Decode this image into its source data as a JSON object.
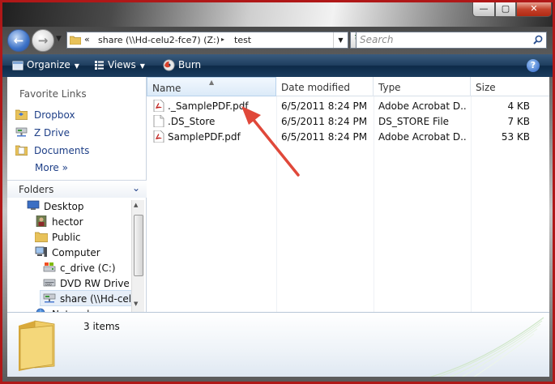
{
  "window": {
    "minimize_glyph": "—",
    "maximize_glyph": "▢",
    "close_glyph": "✕"
  },
  "address": {
    "chevron": "«",
    "crumbs": [
      "share (\\\\Hd-celu2-fce7) (Z:)",
      "test"
    ],
    "separator": "▸",
    "dropdown_glyph": "▼"
  },
  "search": {
    "placeholder": "Search"
  },
  "toolbar": {
    "organize": "Organize",
    "views": "Views",
    "burn": "Burn",
    "help": "?"
  },
  "nav": {
    "favorites_header": "Favorite Links",
    "favorites": [
      "Dropbox",
      "Z Drive",
      "Documents"
    ],
    "more": "More",
    "more_glyph": "»",
    "folders_header": "Folders",
    "folders_chevron": "⌄",
    "tree": {
      "desktop": "Desktop",
      "hector": "hector",
      "public": "Public",
      "computer": "Computer",
      "cdrive": "c_drive (C:)",
      "dvd": "DVD RW Drive (E",
      "share": "share (\\\\Hd-celu",
      "network": "Network"
    }
  },
  "columns": {
    "name": "Name",
    "date": "Date modified",
    "type": "Type",
    "size": "Size"
  },
  "files": [
    {
      "name": "._SamplePDF.pdf",
      "date": "6/5/2011 8:24 PM",
      "type": "Adobe Acrobat D...",
      "size": "4 KB",
      "icon": "pdf-icon"
    },
    {
      "name": ".DS_Store",
      "date": "6/5/2011 8:24 PM",
      "type": "DS_STORE File",
      "size": "7 KB",
      "icon": "blank-file-icon"
    },
    {
      "name": "SamplePDF.pdf",
      "date": "6/5/2011 8:24 PM",
      "type": "Adobe Acrobat D...",
      "size": "53 KB",
      "icon": "pdf-icon"
    }
  ],
  "details": {
    "item_count": "3 items"
  },
  "colors": {
    "frame": "#b01818",
    "toolbar": "#1f3f60",
    "link": "#1e3f87",
    "arrow": "#e0483a"
  }
}
